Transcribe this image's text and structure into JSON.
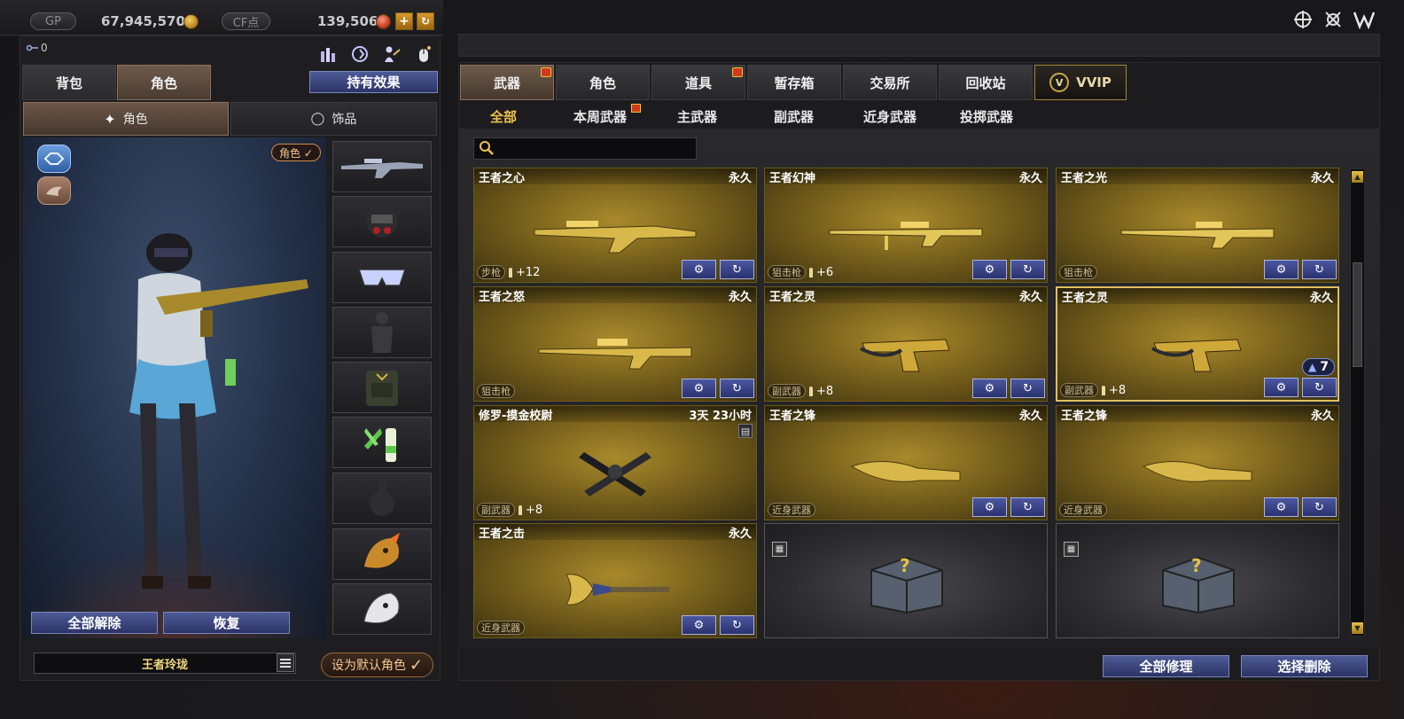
{
  "currency": {
    "gp_label": "GP",
    "gp_value": "67,945,570",
    "cf_label": "CF点",
    "cf_value": "139,506",
    "add_symbol": "+",
    "refresh_symbol": "↻"
  },
  "left": {
    "key_count": "0",
    "tabs": [
      "背包",
      "角色"
    ],
    "effects_button": "持有效果",
    "subtabs": [
      "角色",
      "饰品"
    ],
    "char_badge": "角色 ✓",
    "actions": {
      "release_all": "全部解除",
      "restore": "恢复"
    },
    "char_name": "王者玲珑",
    "default_button": "设为默认角色",
    "default_check": "✓"
  },
  "right": {
    "tabs": [
      "武器",
      "角色",
      "道具",
      "暂存箱",
      "交易所",
      "回收站",
      "VVIP"
    ],
    "subtabs": [
      "全部",
      "本周武器",
      "主武器",
      "副武器",
      "近身武器",
      "投掷武器"
    ],
    "search_placeholder": "",
    "items": [
      {
        "name": "王者之心",
        "duration": "永久",
        "type": "步枪",
        "ammo": "+12"
      },
      {
        "name": "王者幻神",
        "duration": "永久",
        "type": "狙击枪",
        "ammo": "+6"
      },
      {
        "name": "王者之光",
        "duration": "永久",
        "type": "狙击枪",
        "ammo": ""
      },
      {
        "name": "王者之怒",
        "duration": "永久",
        "type": "狙击枪",
        "ammo": ""
      },
      {
        "name": "王者之灵",
        "duration": "永久",
        "type": "副武器",
        "ammo": "+8"
      },
      {
        "name": "王者之灵",
        "duration": "永久",
        "type": "副武器",
        "ammo": "+8",
        "level": "7"
      },
      {
        "name": "修罗-摸金校尉",
        "duration": "3天 23小时",
        "type": "副武器",
        "ammo": "+8"
      },
      {
        "name": "王者之锋",
        "duration": "永久",
        "type": "近身武器",
        "ammo": ""
      },
      {
        "name": "王者之锋",
        "duration": "永久",
        "type": "近身武器",
        "ammo": ""
      },
      {
        "name": "王者之击",
        "duration": "永久",
        "type": "近身武器",
        "ammo": ""
      }
    ],
    "buttons": {
      "repair_all": "全部修理",
      "delete_selected": "选择删除"
    }
  },
  "colors": {
    "gold": "#f1c14a",
    "blue_button": "#3a4582",
    "card_gold": "#a88a2c"
  }
}
